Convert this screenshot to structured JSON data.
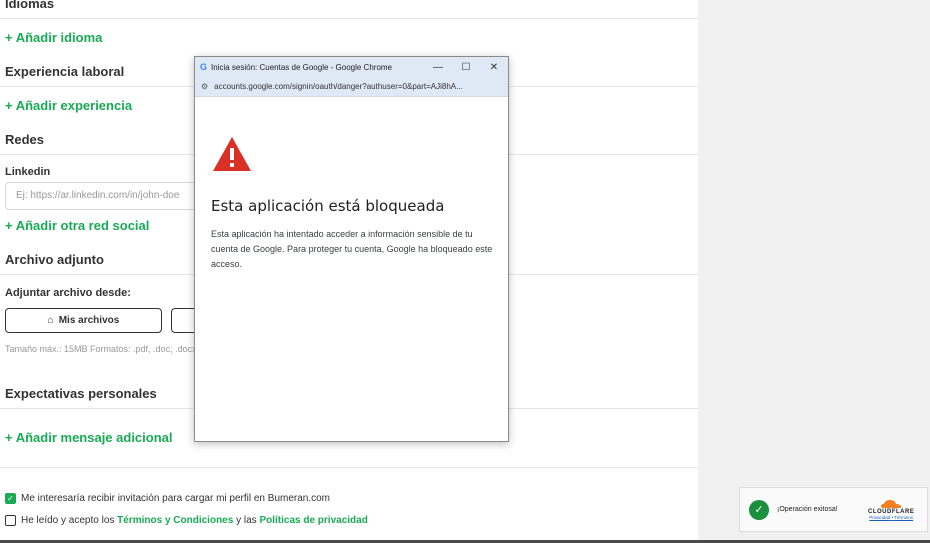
{
  "form": {
    "idiomas_title": "Idiomas",
    "add_idioma": "+ Añadir idioma",
    "experiencia_title": "Experiencia laboral",
    "add_experiencia": "+ Añadir experiencia",
    "redes_title": "Redes",
    "linkedin_label": "Linkedin",
    "linkedin_placeholder": "Ej: https://ar.linkedin.com/in/john-doe",
    "add_red": "+ Añadir otra red social",
    "archivo_title": "Archivo adjunto",
    "adjuntar_label": "Adjuntar archivo desde:",
    "mis_archivos": "Mis archivos",
    "size_hint": "Tamaño máx.: 15MB Formatos: .pdf, .doc, .docx",
    "expectativas_title": "Expectativas personales",
    "add_mensaje": "+ Añadir mensaje adicional",
    "check_invite": "Me interesaría recibir invitación para cargar mi perfil en Bumeran.com",
    "check_terms_prefix": "He leído y acepto los ",
    "terms_link": "Términos y Condiciones",
    "check_terms_mid": " y las ",
    "privacy_link": "Políticas de privacidad"
  },
  "popup": {
    "window_title": "Inicia sesión: Cuentas de Google - Google Chrome",
    "url": "accounts.google.com/signin/oauth/danger?authuser=0&part=AJi8hA...",
    "title": "Esta aplicación está bloqueada",
    "description": "Esta aplicación ha intentado acceder a información sensible de tu cuenta de Google. Para proteger tu cuenta, Google ha bloqueado este acceso."
  },
  "cloudflare": {
    "status": "¡Operación exitosa!",
    "brand": "CLOUDFLARE",
    "privacy": "Privacidad",
    "sep": " • ",
    "terms": "Términos"
  },
  "colors": {
    "accent": "#1aaa55",
    "warning": "#d93025"
  }
}
